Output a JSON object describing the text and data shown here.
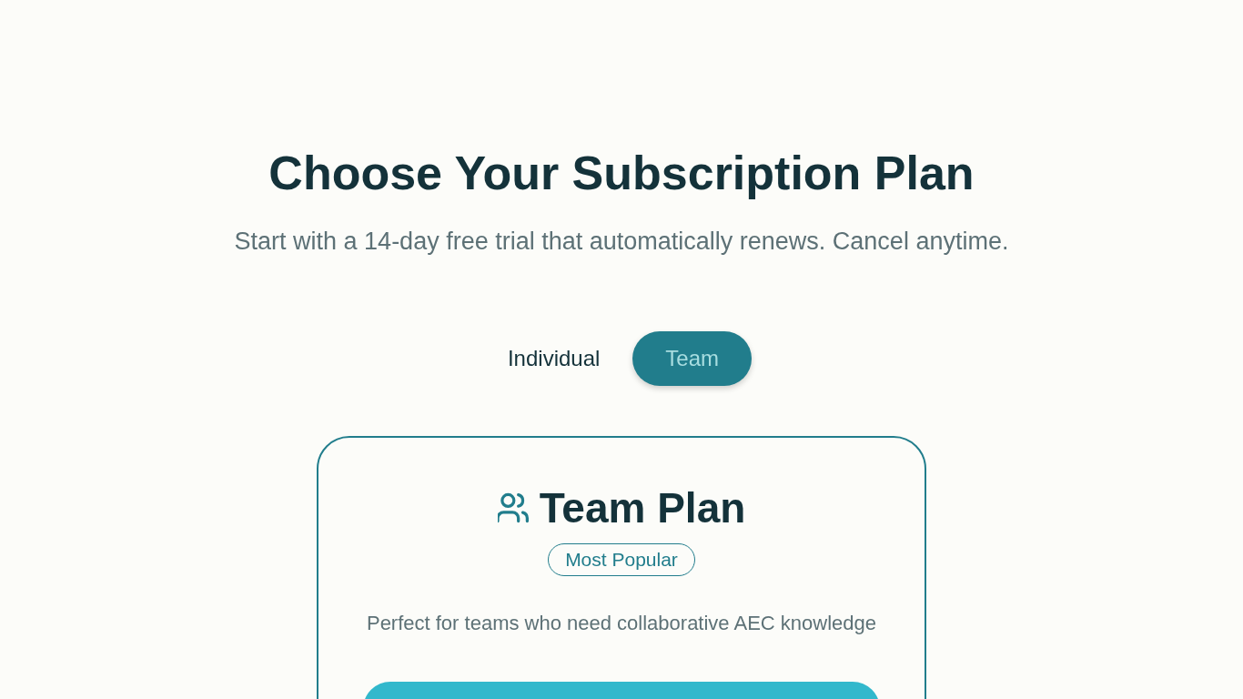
{
  "header": {
    "title": "Choose Your Subscription Plan",
    "subtitle": "Start with a 14-day free trial that automatically renews. Cancel anytime."
  },
  "plan_toggle": [
    {
      "label": "Individual",
      "selected": false
    },
    {
      "label": "Team",
      "selected": true
    }
  ],
  "plan_card": {
    "title": "Team Plan",
    "badge": "Most Popular",
    "description": "Perfect for teams who need collaborative AEC knowledge"
  }
}
